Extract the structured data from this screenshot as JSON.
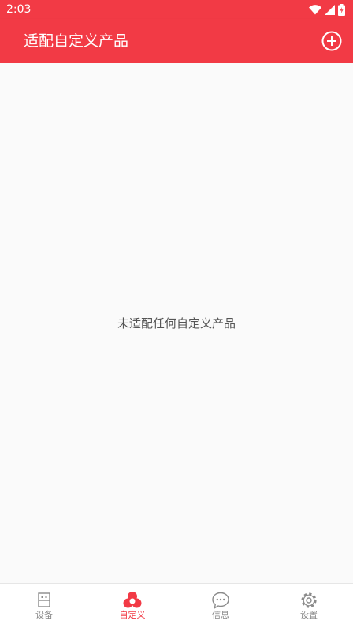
{
  "colors": {
    "accent": "#f23a45",
    "background": "#fafafa",
    "nav_inactive": "#888888",
    "text_muted": "#555555"
  },
  "status_bar": {
    "time": "2:03",
    "icons": [
      "wifi-icon",
      "signal-icon",
      "battery-icon"
    ]
  },
  "app_bar": {
    "title": "适配自定义产品",
    "action_icon": "add-circle-icon"
  },
  "main": {
    "empty_message": "未适配任何自定义产品"
  },
  "bottom_nav": {
    "items": [
      {
        "label": "设备",
        "icon": "device-icon",
        "active": false
      },
      {
        "label": "自定义",
        "icon": "custom-icon",
        "active": true
      },
      {
        "label": "信息",
        "icon": "message-icon",
        "active": false
      },
      {
        "label": "设置",
        "icon": "settings-icon",
        "active": false
      }
    ]
  }
}
